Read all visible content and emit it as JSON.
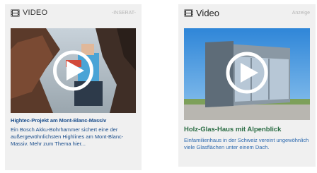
{
  "cards": [
    {
      "header_label": "VIDEO",
      "ad_label": "-INSERAT-",
      "title": "Hightec-Projekt am Mont-Blanc-Massiv",
      "description": "Ein Bosch Akku-Bohrhammer sichert eine der außergewöhnlichsten Highlines am Mont-Blanc-Massiv. Mehr zum Thema hier..."
    },
    {
      "header_label": "Video",
      "ad_label": "Anzeige",
      "title": "Holz-Glas-Haus mit Alpenblick",
      "description": "Einfamilienhaus in der Schweiz vereint ungewöhnlich viele Glasflächen unter einem Dach."
    }
  ],
  "colors": {
    "card_background": "#f0f0f0",
    "title_blue": "#1b4e8c",
    "title_green": "#2a6c43",
    "link_blue": "#2e6bb0"
  },
  "icons": {
    "header": "film-icon",
    "overlay": "play-icon"
  }
}
